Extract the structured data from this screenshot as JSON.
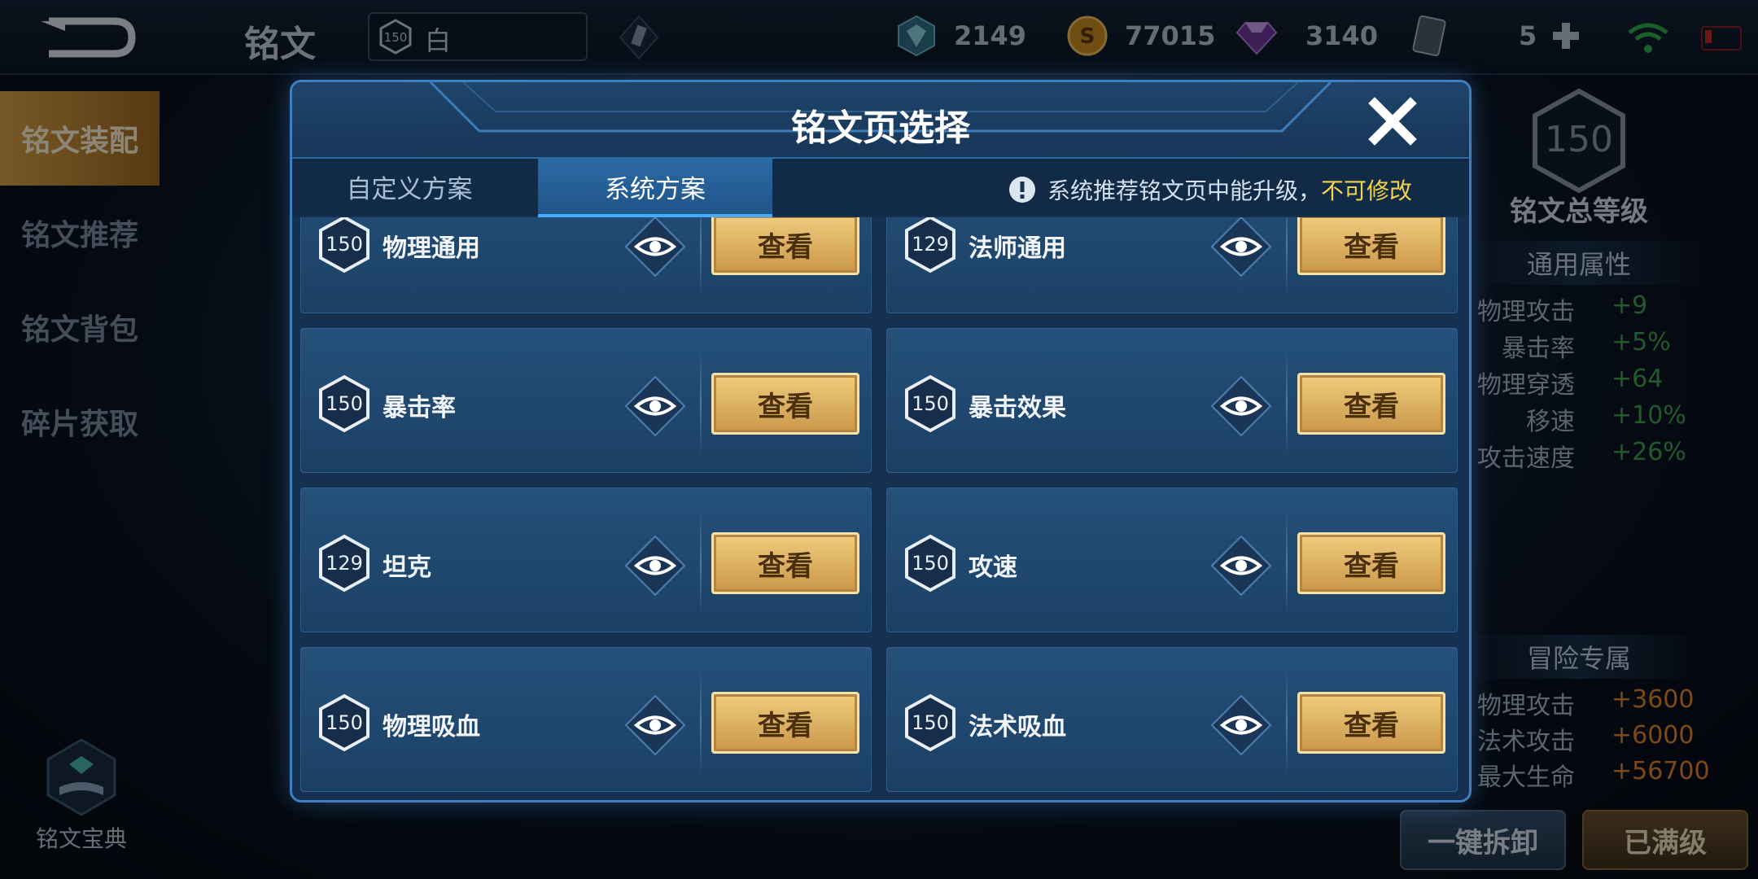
{
  "topbar": {
    "title": "铭文",
    "page_level": "150",
    "page_name": "白",
    "currencies": [
      {
        "icon": "crystal-icon",
        "value": "2149"
      },
      {
        "icon": "gold-coin-icon",
        "value": "77015"
      },
      {
        "icon": "gem-icon",
        "value": "3140"
      },
      {
        "icon": "card-icon",
        "value": "5"
      }
    ]
  },
  "leftnav": {
    "items": [
      {
        "label": "铭文装配",
        "active": true
      },
      {
        "label": "铭文推荐",
        "active": false
      },
      {
        "label": "铭文背包",
        "active": false
      },
      {
        "label": "碎片获取",
        "active": false
      }
    ],
    "codex_label": "铭文宝典"
  },
  "rightpanel": {
    "total_level": "150",
    "total_label": "铭文总等级",
    "general_header": "通用属性",
    "general_stats": [
      {
        "k": "物理攻击",
        "v": "+9"
      },
      {
        "k": "暴击率",
        "v": "+5%"
      },
      {
        "k": "物理穿透",
        "v": "+64"
      },
      {
        "k": "移速",
        "v": "+10%"
      },
      {
        "k": "攻击速度",
        "v": "+26%"
      }
    ],
    "adventure_header": "冒险专属",
    "adventure_stats": [
      {
        "k": "物理攻击",
        "v": "+3600"
      },
      {
        "k": "法术攻击",
        "v": "+6000"
      },
      {
        "k": "最大生命",
        "v": "+56700"
      }
    ],
    "dismantle_label": "一键拆卸",
    "maxed_label": "已满级"
  },
  "modal": {
    "title": "铭文页选择",
    "tabs": [
      {
        "label": "自定义方案",
        "active": false
      },
      {
        "label": "系统方案",
        "active": true
      }
    ],
    "notice_text": "系统推荐铭文页中能升级，",
    "notice_highlight": "不可修改",
    "view_label": "查看",
    "cards": [
      {
        "level": "150",
        "name": "物理通用"
      },
      {
        "level": "129",
        "name": "法师通用"
      },
      {
        "level": "150",
        "name": "暴击率"
      },
      {
        "level": "150",
        "name": "暴击效果"
      },
      {
        "level": "129",
        "name": "坦克"
      },
      {
        "level": "150",
        "name": "攻速"
      },
      {
        "level": "150",
        "name": "物理吸血"
      },
      {
        "level": "150",
        "name": "法术吸血"
      }
    ]
  }
}
